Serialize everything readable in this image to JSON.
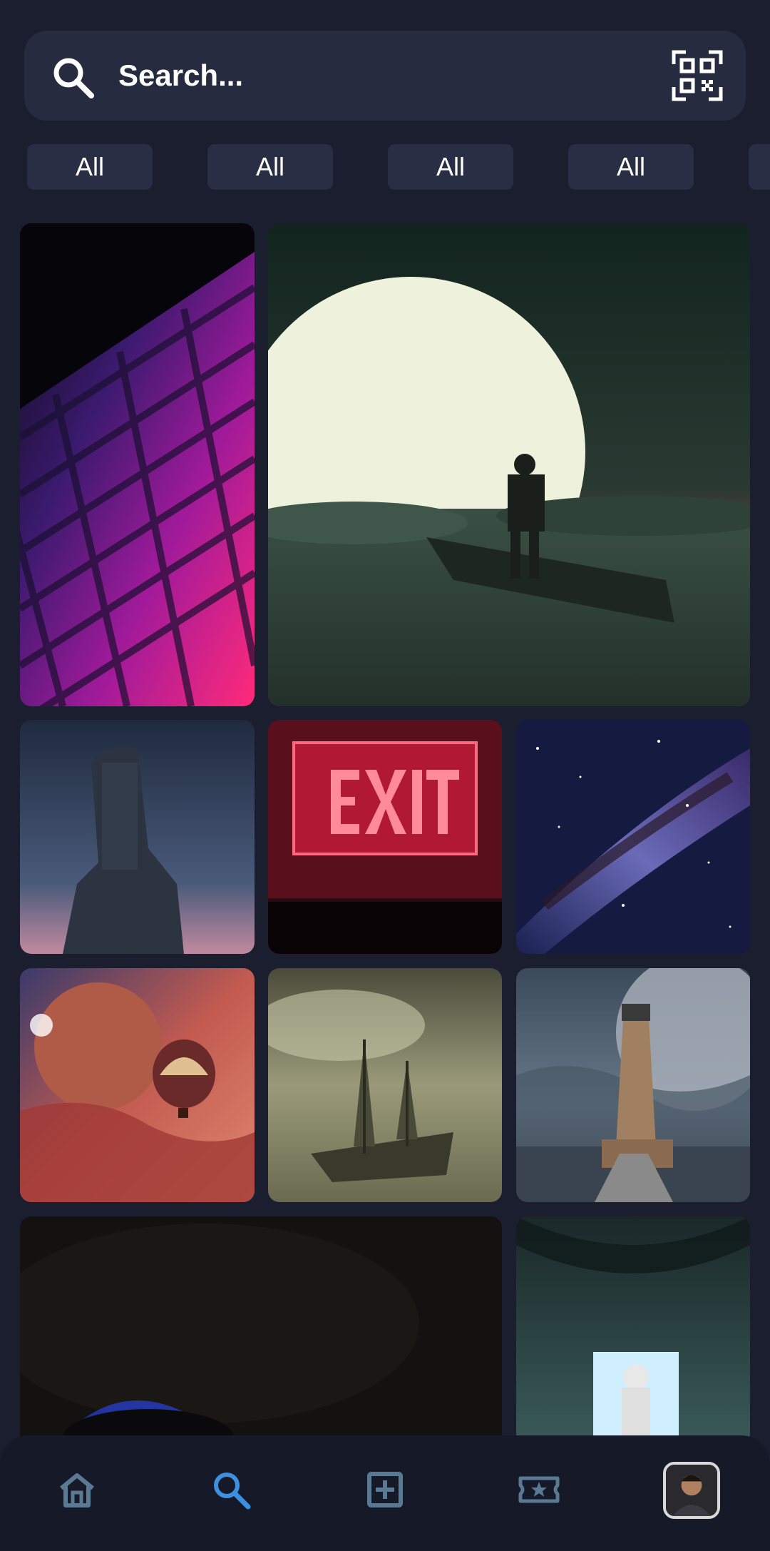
{
  "search": {
    "placeholder": "Search...",
    "search_icon": "search-icon",
    "qr_icon": "qr-code-icon"
  },
  "filters": [
    {
      "label": "All"
    },
    {
      "label": "All"
    },
    {
      "label": "All"
    },
    {
      "label": "All"
    },
    {
      "label": ""
    }
  ],
  "gallery": [
    {
      "subject": "neon keyboard"
    },
    {
      "subject": "moon over clouds with boat"
    },
    {
      "subject": "moai statue under stars"
    },
    {
      "subject": "exit sign"
    },
    {
      "subject": "milky way"
    },
    {
      "subject": "hot air balloon and planet"
    },
    {
      "subject": "ghost ship"
    },
    {
      "subject": "lighthouse and moon"
    },
    {
      "subject": "dark eye close-up"
    },
    {
      "subject": "astronaut in forest doorway"
    }
  ],
  "nav": {
    "items": [
      {
        "icon": "home-icon"
      },
      {
        "icon": "search-icon",
        "active": true
      },
      {
        "icon": "add-box-icon"
      },
      {
        "icon": "ticket-star-icon"
      },
      {
        "icon": "profile-avatar"
      }
    ]
  },
  "colors": {
    "background": "#1b1e2e",
    "surface": "#272b40",
    "chip": "#2a2e45",
    "nav_background": "#161a28",
    "nav_icon": "#5a7a93",
    "nav_active": "#3d8fe0"
  }
}
